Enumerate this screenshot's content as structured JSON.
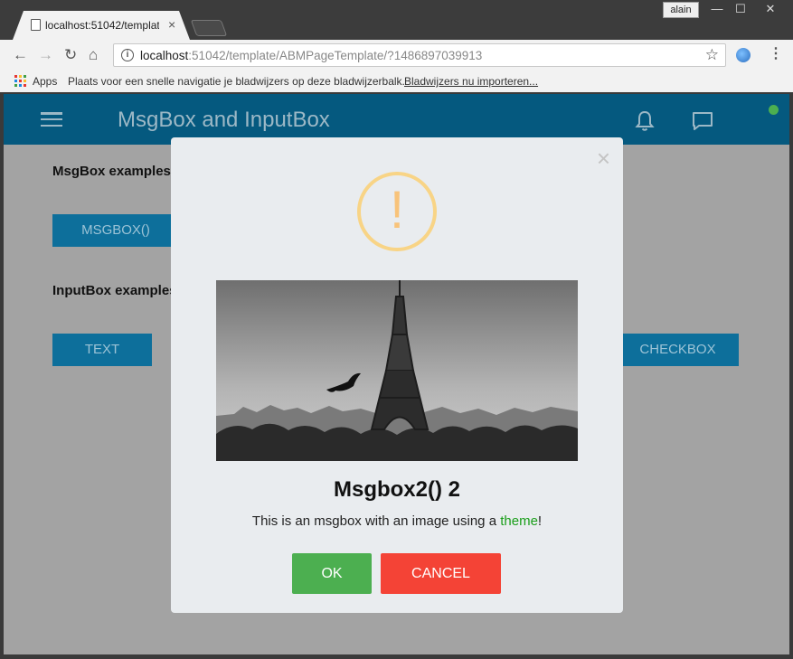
{
  "browser": {
    "tab_title": "localhost:51042/template",
    "tab_close": "×",
    "user_badge": "alain",
    "window_controls": {
      "minimize": "—",
      "maximize": "☐",
      "close": "✕"
    },
    "toolbar": {
      "back": "←",
      "forward": "→",
      "reload": "↻",
      "home": "⌂",
      "star": "☆",
      "menu": "⋮"
    },
    "url_host": "localhost",
    "url_rest": ":51042/template/ABMPageTemplate/?1486897039913",
    "info_icon": "i"
  },
  "bookmarks": {
    "apps_label": "Apps",
    "hint_text": "Plaats voor een snelle navigatie je bladwijzers op deze bladwijzerbalk.",
    "import_link": "Bladwijzers nu importeren...",
    "apps_colors": [
      "#e53935",
      "#fbc02d",
      "#43a047",
      "#1e88e5",
      "#e53935",
      "#fbc02d",
      "#43a047",
      "#1e88e5",
      "#e53935"
    ]
  },
  "appbar": {
    "title": "MsgBox and InputBox",
    "icons": [
      "menu-icon",
      "bell-icon",
      "chat-icon"
    ],
    "status_color": "#4caf50"
  },
  "page": {
    "msgbox_section": "MsgBox examples",
    "msgbox_button": "MSGBOX()",
    "inputbox_section": "InputBox examples",
    "text_button": "TEXT",
    "checkbox_button": "CHECKBOX"
  },
  "modal": {
    "close": "×",
    "warning_glyph": "!",
    "title": "Msgbox2() 2",
    "text_before": "This is an msgbox with an image using a ",
    "text_link": "theme",
    "text_after": "!",
    "ok_label": "OK",
    "cancel_label": "CANCEL",
    "colors": {
      "ok": "#4caf50",
      "cancel": "#f44336",
      "warning": "#f8d486",
      "theme_link": "#1a9e1a"
    }
  }
}
